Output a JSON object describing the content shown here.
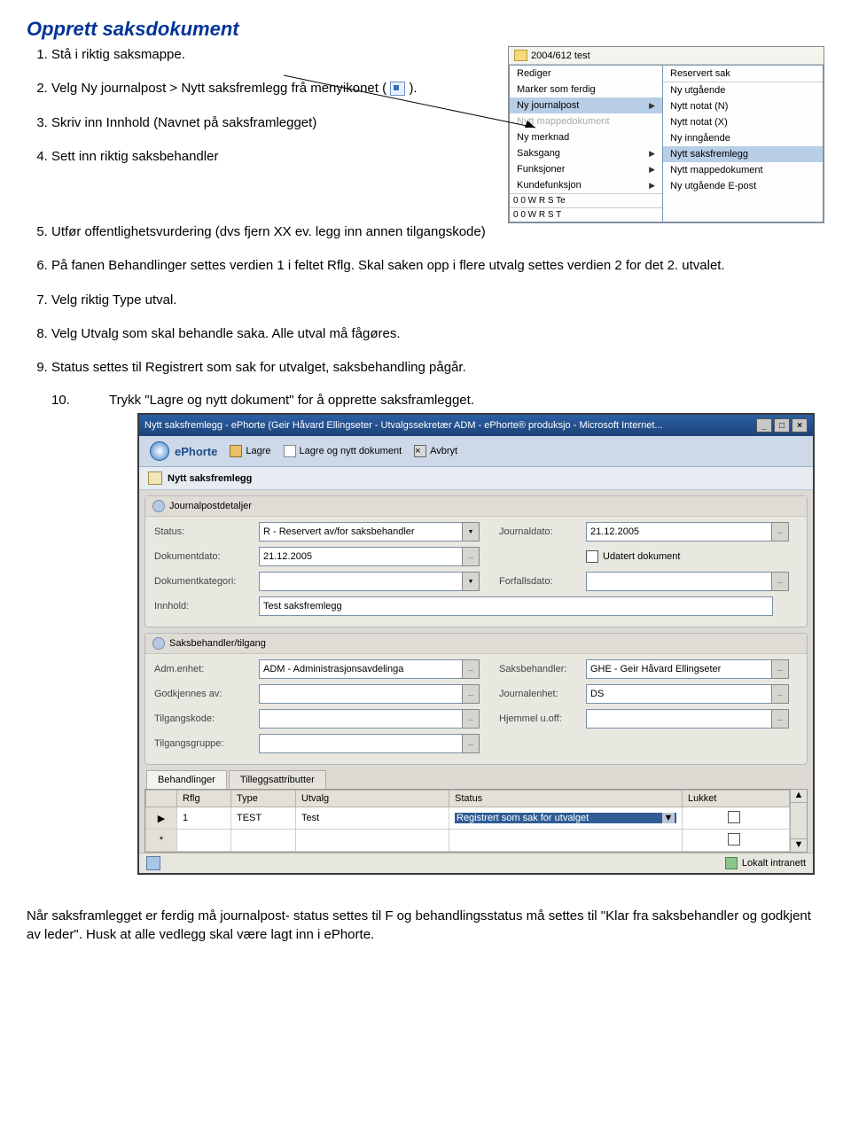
{
  "title": "Opprett saksdokument",
  "steps": {
    "s1": "Stå i riktig saksmappe.",
    "s2a": "Velg Ny journalpost > Nytt saksfremlegg frå menyikonet (",
    "s2b": ").",
    "s3": "Skriv inn Innhold (Navnet på saksframlegget)",
    "s4": "Sett inn riktig saksbehandler",
    "s5": "Utfør offentlighetsvurdering (dvs fjern XX ev. legg inn annen tilgangskode)",
    "s6": "På fanen Behandlinger settes verdien 1 i feltet Rflg. Skal saken opp i flere utvalg settes verdien 2 for det 2. utvalet.",
    "s7": "Velg riktig Type utval.",
    "s8": "Velg Utvalg som skal behandle saka. Alle utval må fågøres.",
    "s9": "Status settes til Registrert som sak for utvalget, saksbehandling pågår.",
    "s10_num": "10.",
    "s10": "Trykk \"Lagre og nytt dokument\" for å opprette saksframlegget."
  },
  "ctx": {
    "folder": "2004/612  test",
    "left": [
      "Rediger",
      "Marker som ferdig",
      "Ny journalpost",
      "Nytt mappedokument",
      "Ny merknad",
      "Saksgang",
      "Funksjoner",
      "Kundefunksjon"
    ],
    "right": [
      "Reservert sak",
      "Ny utgående",
      "Nytt notat (N)",
      "Nytt notat (X)",
      "Ny inngående",
      "Nytt saksfremlegg",
      "Nytt mappedokument",
      "Ny utgående E-post"
    ],
    "status1": "0   0 W   R  S  Te",
    "status2": "0   0 W   R  S  T"
  },
  "dlg": {
    "title": "Nytt saksfremlegg - ePhorte (Geir Håvard Ellingseter - Utvalgssekretær ADM - ePhorte® produksjo - Microsoft Internet...",
    "brand": "ePhorte",
    "tb": {
      "lagre": "Lagre",
      "lagrenytt": "Lagre og nytt dokument",
      "avbryt": "Avbryt"
    },
    "sub": "Nytt saksfremlegg",
    "sec1": "Journalpostdetaljer",
    "status_l": "Status:",
    "status_v": "R - Reservert av/for saksbehandler",
    "journaldato_l": "Journaldato:",
    "journaldato_v": "21.12.2005",
    "dokdato_l": "Dokumentdato:",
    "dokdato_v": "21.12.2005",
    "udatert": "Udatert dokument",
    "dokkat_l": "Dokumentkategori:",
    "forfall_l": "Forfallsdato:",
    "innhold_l": "Innhold:",
    "innhold_v": "Test saksfremlegg",
    "sec2": "Saksbehandler/tilgang",
    "adm_l": "Adm.enhet:",
    "adm_v": "ADM - Administrasjonsavdelinga",
    "saksbeh_l": "Saksbehandler:",
    "saksbeh_v": "GHE - Geir Håvard Ellingseter",
    "godkj_l": "Godkjennes av:",
    "jenhet_l": "Journalenhet:",
    "jenhet_v": "DS",
    "tilgkode_l": "Tilgangskode:",
    "hjemmel_l": "Hjemmel u.off:",
    "tilggrp_l": "Tilgangsgruppe:",
    "tab1": "Behandlinger",
    "tab2": "Tilleggsattributter",
    "col1": "Rflg",
    "col2": "Type",
    "col3": "Utvalg",
    "col4": "Status",
    "col5": "Lukket",
    "r1a": "1",
    "r1b": "TEST",
    "r1c": "Test",
    "r1d": "Registrert som sak for utvalget",
    "intranet": "Lokalt intranett"
  },
  "footer": "Når saksframlegget er ferdig må journalpost- status settes til F og behandlingsstatus må settes til \"Klar fra saksbehandler og godkjent av leder\". Husk at alle vedlegg skal være lagt inn i ePhorte."
}
